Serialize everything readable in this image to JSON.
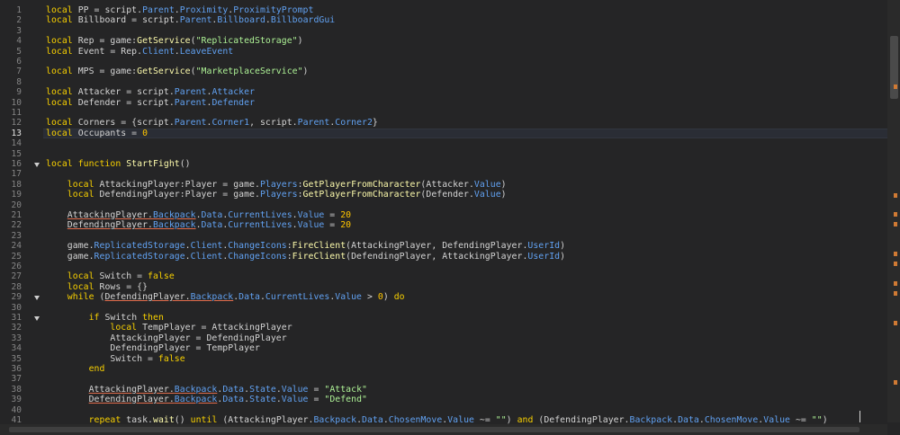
{
  "editor": {
    "current_line": 13,
    "lines": [
      {
        "n": "1",
        "tokens": [
          [
            "kw",
            "local"
          ],
          [
            "plain",
            " PP = script."
          ],
          [
            "prop",
            "Parent"
          ],
          [
            "plain",
            "."
          ],
          [
            "prop",
            "Proximity"
          ],
          [
            "plain",
            "."
          ],
          [
            "prop",
            "ProximityPrompt"
          ]
        ]
      },
      {
        "n": "2",
        "tokens": [
          [
            "kw",
            "local"
          ],
          [
            "plain",
            " Billboard = script."
          ],
          [
            "prop",
            "Parent"
          ],
          [
            "plain",
            "."
          ],
          [
            "prop",
            "Billboard"
          ],
          [
            "plain",
            "."
          ],
          [
            "prop",
            "BillboardGui"
          ]
        ]
      },
      {
        "n": "3",
        "tokens": []
      },
      {
        "n": "4",
        "tokens": [
          [
            "kw",
            "local"
          ],
          [
            "plain",
            " Rep = game:"
          ],
          [
            "meth",
            "GetService"
          ],
          [
            "plain",
            "("
          ],
          [
            "str",
            "\"ReplicatedStorage\""
          ],
          [
            "plain",
            ")"
          ]
        ]
      },
      {
        "n": "5",
        "tokens": [
          [
            "kw",
            "local"
          ],
          [
            "plain",
            " Event = Rep."
          ],
          [
            "prop",
            "Client"
          ],
          [
            "plain",
            "."
          ],
          [
            "prop",
            "LeaveEvent"
          ]
        ]
      },
      {
        "n": "6",
        "tokens": []
      },
      {
        "n": "7",
        "tokens": [
          [
            "kw",
            "local"
          ],
          [
            "plain",
            " MPS = game:"
          ],
          [
            "meth",
            "GetService"
          ],
          [
            "plain",
            "("
          ],
          [
            "str",
            "\"MarketplaceService\""
          ],
          [
            "plain",
            ")"
          ]
        ]
      },
      {
        "n": "8",
        "tokens": []
      },
      {
        "n": "9",
        "tokens": [
          [
            "kw",
            "local"
          ],
          [
            "plain",
            " Attacker = script."
          ],
          [
            "prop",
            "Parent"
          ],
          [
            "plain",
            "."
          ],
          [
            "prop",
            "Attacker"
          ]
        ]
      },
      {
        "n": "10",
        "tokens": [
          [
            "kw",
            "local"
          ],
          [
            "plain",
            " Defender = script."
          ],
          [
            "prop",
            "Parent"
          ],
          [
            "plain",
            "."
          ],
          [
            "prop",
            "Defender"
          ]
        ]
      },
      {
        "n": "11",
        "tokens": []
      },
      {
        "n": "12",
        "tokens": [
          [
            "kw",
            "local"
          ],
          [
            "plain",
            " Corners = {script."
          ],
          [
            "prop",
            "Parent"
          ],
          [
            "plain",
            "."
          ],
          [
            "prop",
            "Corner1"
          ],
          [
            "plain",
            ", script."
          ],
          [
            "prop",
            "Parent"
          ],
          [
            "plain",
            "."
          ],
          [
            "prop",
            "Corner2"
          ],
          [
            "plain",
            "}"
          ]
        ]
      },
      {
        "n": "13",
        "tokens": [
          [
            "kw",
            "local"
          ],
          [
            "plain",
            " Occupants = "
          ],
          [
            "num",
            "0"
          ]
        ]
      },
      {
        "n": "14",
        "tokens": []
      },
      {
        "n": "15",
        "tokens": []
      },
      {
        "n": "16",
        "fold": true,
        "tokens": [
          [
            "kw",
            "local function"
          ],
          [
            "plain",
            " "
          ],
          [
            "meth",
            "StartFight"
          ],
          [
            "plain",
            "()"
          ]
        ]
      },
      {
        "n": "17",
        "tokens": []
      },
      {
        "n": "18",
        "tokens": [
          [
            "plain",
            "    "
          ],
          [
            "kw",
            "local"
          ],
          [
            "plain",
            " AttackingPlayer:Player = game."
          ],
          [
            "prop",
            "Players"
          ],
          [
            "plain",
            ":"
          ],
          [
            "meth",
            "GetPlayerFromCharacter"
          ],
          [
            "plain",
            "(Attacker."
          ],
          [
            "prop",
            "Value"
          ],
          [
            "plain",
            ")"
          ]
        ]
      },
      {
        "n": "19",
        "tokens": [
          [
            "plain",
            "    "
          ],
          [
            "kw",
            "local"
          ],
          [
            "plain",
            " DefendingPlayer:Player = game."
          ],
          [
            "prop",
            "Players"
          ],
          [
            "plain",
            ":"
          ],
          [
            "meth",
            "GetPlayerFromCharacter"
          ],
          [
            "plain",
            "(Defender."
          ],
          [
            "prop",
            "Value"
          ],
          [
            "plain",
            ")"
          ]
        ]
      },
      {
        "n": "20",
        "tokens": []
      },
      {
        "n": "21",
        "tokens": [
          [
            "plain",
            "    "
          ],
          [
            "ul",
            "AttackingPlayer."
          ],
          [
            "ulprop",
            "Backpack"
          ],
          [
            "plain",
            "."
          ],
          [
            "prop",
            "Data"
          ],
          [
            "plain",
            "."
          ],
          [
            "prop",
            "CurrentLives"
          ],
          [
            "plain",
            "."
          ],
          [
            "prop",
            "Value"
          ],
          [
            "plain",
            " = "
          ],
          [
            "num",
            "20"
          ]
        ]
      },
      {
        "n": "22",
        "tokens": [
          [
            "plain",
            "    "
          ],
          [
            "ul",
            "DefendingPlayer."
          ],
          [
            "ulprop",
            "Backpack"
          ],
          [
            "plain",
            "."
          ],
          [
            "prop",
            "Data"
          ],
          [
            "plain",
            "."
          ],
          [
            "prop",
            "CurrentLives"
          ],
          [
            "plain",
            "."
          ],
          [
            "prop",
            "Value"
          ],
          [
            "plain",
            " = "
          ],
          [
            "num",
            "20"
          ]
        ]
      },
      {
        "n": "23",
        "tokens": []
      },
      {
        "n": "24",
        "tokens": [
          [
            "plain",
            "    game."
          ],
          [
            "prop",
            "ReplicatedStorage"
          ],
          [
            "plain",
            "."
          ],
          [
            "prop",
            "Client"
          ],
          [
            "plain",
            "."
          ],
          [
            "prop",
            "ChangeIcons"
          ],
          [
            "plain",
            ":"
          ],
          [
            "meth",
            "FireClient"
          ],
          [
            "plain",
            "(AttackingPlayer, DefendingPlayer."
          ],
          [
            "prop",
            "UserId"
          ],
          [
            "plain",
            ")"
          ]
        ]
      },
      {
        "n": "25",
        "tokens": [
          [
            "plain",
            "    game."
          ],
          [
            "prop",
            "ReplicatedStorage"
          ],
          [
            "plain",
            "."
          ],
          [
            "prop",
            "Client"
          ],
          [
            "plain",
            "."
          ],
          [
            "prop",
            "ChangeIcons"
          ],
          [
            "plain",
            ":"
          ],
          [
            "meth",
            "FireClient"
          ],
          [
            "plain",
            "(DefendingPlayer, AttackingPlayer."
          ],
          [
            "prop",
            "UserId"
          ],
          [
            "plain",
            ")"
          ]
        ]
      },
      {
        "n": "26",
        "tokens": []
      },
      {
        "n": "27",
        "tokens": [
          [
            "plain",
            "    "
          ],
          [
            "kw",
            "local"
          ],
          [
            "plain",
            " Switch = "
          ],
          [
            "kw",
            "false"
          ]
        ]
      },
      {
        "n": "28",
        "tokens": [
          [
            "plain",
            "    "
          ],
          [
            "kw",
            "local"
          ],
          [
            "plain",
            " Rows = {}"
          ]
        ]
      },
      {
        "n": "29",
        "fold": true,
        "tokens": [
          [
            "plain",
            "    "
          ],
          [
            "kw",
            "while"
          ],
          [
            "plain",
            " ("
          ],
          [
            "ul",
            "DefendingPlayer."
          ],
          [
            "ulprop",
            "Backpack"
          ],
          [
            "plain",
            "."
          ],
          [
            "prop",
            "Data"
          ],
          [
            "plain",
            "."
          ],
          [
            "prop",
            "CurrentLives"
          ],
          [
            "plain",
            "."
          ],
          [
            "prop",
            "Value"
          ],
          [
            "plain",
            " > "
          ],
          [
            "num",
            "0"
          ],
          [
            "plain",
            ") "
          ],
          [
            "kw",
            "do"
          ]
        ]
      },
      {
        "n": "30",
        "tokens": []
      },
      {
        "n": "31",
        "fold": true,
        "tokens": [
          [
            "plain",
            "        "
          ],
          [
            "kw",
            "if"
          ],
          [
            "plain",
            " Switch "
          ],
          [
            "kw",
            "then"
          ]
        ]
      },
      {
        "n": "32",
        "tokens": [
          [
            "plain",
            "            "
          ],
          [
            "kw",
            "local"
          ],
          [
            "plain",
            " TempPlayer = AttackingPlayer"
          ]
        ]
      },
      {
        "n": "33",
        "tokens": [
          [
            "plain",
            "            AttackingPlayer = DefendingPlayer"
          ]
        ]
      },
      {
        "n": "34",
        "tokens": [
          [
            "plain",
            "            DefendingPlayer = TempPlayer"
          ]
        ]
      },
      {
        "n": "35",
        "tokens": [
          [
            "plain",
            "            Switch = "
          ],
          [
            "kw",
            "false"
          ]
        ]
      },
      {
        "n": "36",
        "tokens": [
          [
            "plain",
            "        "
          ],
          [
            "kw",
            "end"
          ]
        ]
      },
      {
        "n": "37",
        "tokens": []
      },
      {
        "n": "38",
        "tokens": [
          [
            "plain",
            "        "
          ],
          [
            "ul",
            "AttackingPlayer."
          ],
          [
            "ulprop",
            "Backpack"
          ],
          [
            "plain",
            "."
          ],
          [
            "prop",
            "Data"
          ],
          [
            "plain",
            "."
          ],
          [
            "prop",
            "State"
          ],
          [
            "plain",
            "."
          ],
          [
            "prop",
            "Value"
          ],
          [
            "plain",
            " = "
          ],
          [
            "str",
            "\"Attack\""
          ]
        ]
      },
      {
        "n": "39",
        "tokens": [
          [
            "plain",
            "        "
          ],
          [
            "ul",
            "DefendingPlayer."
          ],
          [
            "ulprop",
            "Backpack"
          ],
          [
            "plain",
            "."
          ],
          [
            "prop",
            "Data"
          ],
          [
            "plain",
            "."
          ],
          [
            "prop",
            "State"
          ],
          [
            "plain",
            "."
          ],
          [
            "prop",
            "Value"
          ],
          [
            "plain",
            " = "
          ],
          [
            "str",
            "\"Defend\""
          ]
        ]
      },
      {
        "n": "40",
        "tokens": []
      },
      {
        "n": "41",
        "tokens": [
          [
            "plain",
            "        "
          ],
          [
            "kw",
            "repeat"
          ],
          [
            "plain",
            " task."
          ],
          [
            "meth",
            "wait"
          ],
          [
            "plain",
            "() "
          ],
          [
            "kw",
            "until"
          ],
          [
            "plain",
            " (AttackingPlayer."
          ],
          [
            "prop",
            "Backpack"
          ],
          [
            "plain",
            "."
          ],
          [
            "prop",
            "Data"
          ],
          [
            "plain",
            "."
          ],
          [
            "prop",
            "ChosenMove"
          ],
          [
            "plain",
            "."
          ],
          [
            "prop",
            "Value"
          ],
          [
            "plain",
            " ~= "
          ],
          [
            "str",
            "\"\""
          ],
          [
            "plain",
            ") "
          ],
          [
            "kw",
            "and"
          ],
          [
            "plain",
            " (DefendingPlayer."
          ],
          [
            "prop",
            "Backpack"
          ],
          [
            "plain",
            "."
          ],
          [
            "prop",
            "Data"
          ],
          [
            "plain",
            "."
          ],
          [
            "prop",
            "ChosenMove"
          ],
          [
            "plain",
            "."
          ],
          [
            "prop",
            "Value"
          ],
          [
            "plain",
            " ~= "
          ],
          [
            "str",
            "\"\""
          ],
          [
            "plain",
            ")"
          ]
        ]
      }
    ]
  },
  "scrollbar": {
    "markers": [
      8,
      19,
      21,
      22,
      25,
      26,
      28,
      29,
      32,
      38
    ]
  }
}
